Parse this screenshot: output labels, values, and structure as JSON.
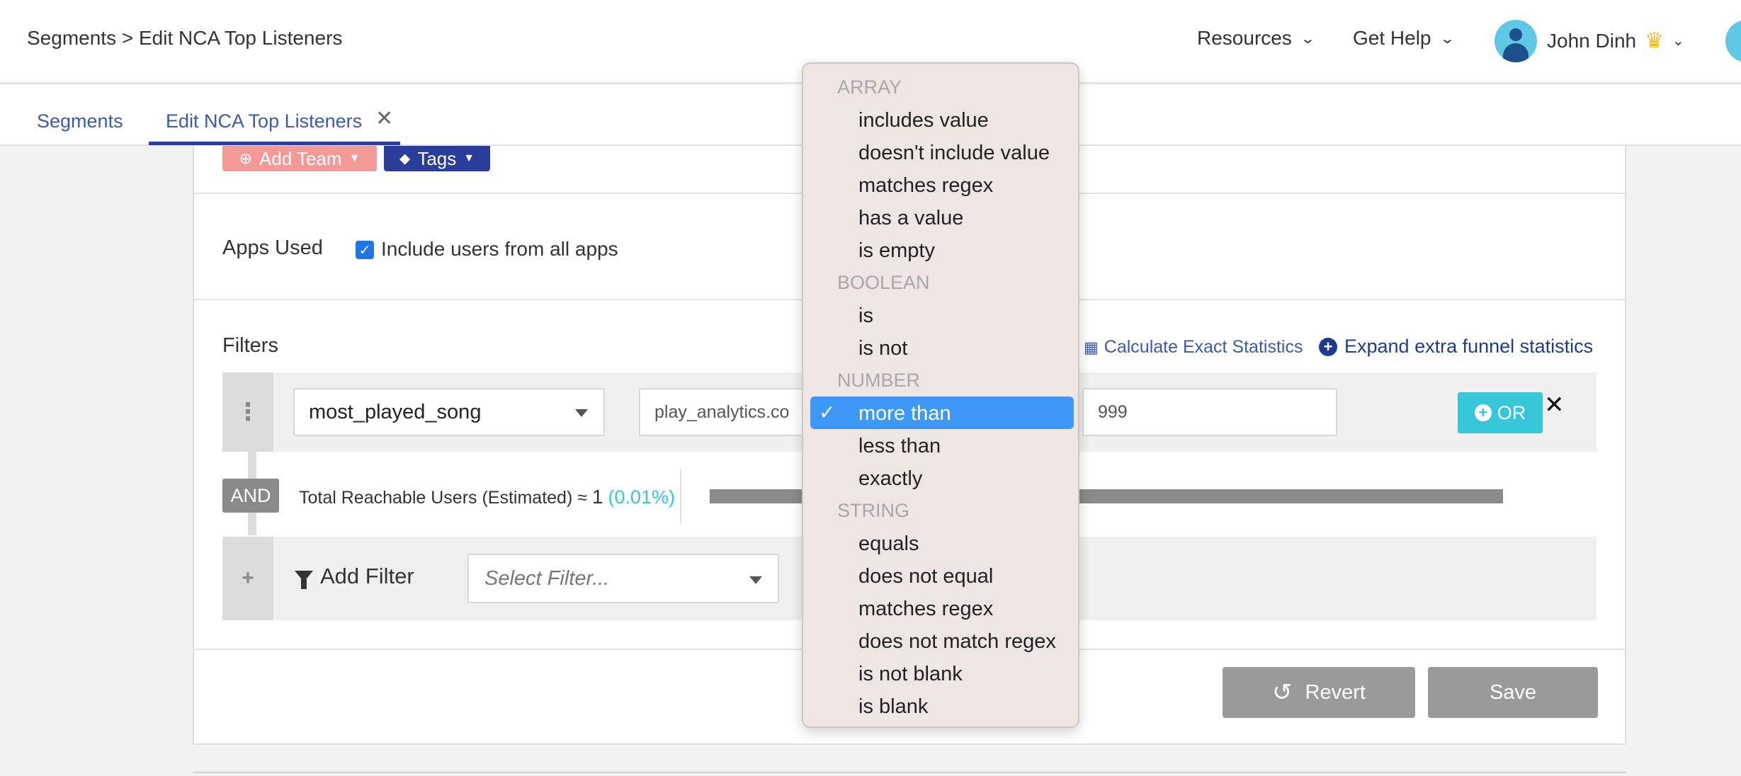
{
  "header": {
    "breadcrumb": "Segments > Edit NCA Top Listeners",
    "resources_label": "Resources",
    "help_label": "Get Help",
    "user_name": "John Dinh"
  },
  "tabs": [
    {
      "label": "Segments"
    },
    {
      "label": "Edit NCA Top Listeners"
    }
  ],
  "toolbar": {
    "team_label": "Add Team",
    "tags_label": "Tags"
  },
  "apps": {
    "label": "Apps Used",
    "checkbox_label": "Include users from all apps",
    "checked": true
  },
  "filters": {
    "label": "Filters",
    "calc_link": "Calculate Exact Statistics",
    "expand_link": "Expand extra funnel statistics",
    "row": {
      "property": "most_played_song",
      "source": "play_analytics.co",
      "value": "999",
      "or_label": "OR"
    },
    "and_label": "AND",
    "reach_prefix": "Total Reachable Users (Estimated) ≈",
    "reach_count": "1",
    "reach_pct": "(0.01%)",
    "add_filter_label": "Add Filter",
    "select_placeholder": "Select Filter..."
  },
  "actions": {
    "revert_label": "Revert",
    "save_label": "Save"
  },
  "dropdown": {
    "groups": [
      {
        "label": "ARRAY",
        "items": [
          "includes value",
          "doesn't include value",
          "matches regex",
          "has a value",
          "is empty"
        ]
      },
      {
        "label": "BOOLEAN",
        "items": [
          "is",
          "is not"
        ]
      },
      {
        "label": "NUMBER",
        "items": [
          "more than",
          "less than",
          "exactly"
        ]
      },
      {
        "label": "STRING",
        "items": [
          "equals",
          "does not equal",
          "matches regex",
          "does not match regex",
          "is not blank",
          "is blank"
        ]
      }
    ],
    "selected": "more than",
    "check_glyph": "✓"
  },
  "colors": {
    "accent": "#2a3d9a",
    "cyan": "#37c7d8",
    "selected": "#3d98f7"
  }
}
